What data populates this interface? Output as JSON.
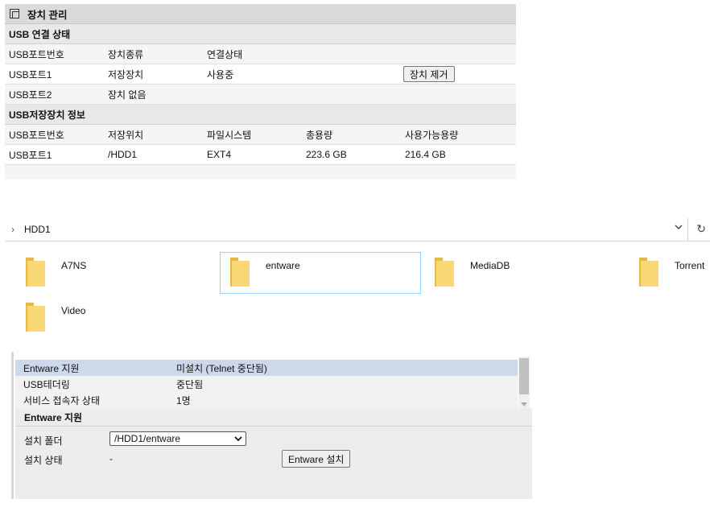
{
  "device_mgmt": {
    "title": "장치 관리",
    "usb_conn": {
      "section": "USB 연결 상태",
      "headers": [
        "USB포트번호",
        "장치종류",
        "연결상태"
      ],
      "rows": [
        {
          "port": "USB포트1",
          "type": "저장장치",
          "status": "사용중",
          "action": "장치 제거"
        },
        {
          "port": "USB포트2",
          "type": "장치 없음",
          "status": ""
        }
      ]
    },
    "storage": {
      "section": "USB저장장치 정보",
      "headers": [
        "USB포트번호",
        "저장위치",
        "파일시스템",
        "총용량",
        "사용가능용량"
      ],
      "rows": [
        {
          "port": "USB포트1",
          "location": "/HDD1",
          "fs": "EXT4",
          "total": "223.6 GB",
          "free": "216.4 GB"
        }
      ]
    }
  },
  "explorer": {
    "path": "HDD1",
    "folders": [
      "A7NS",
      "entware",
      "MediaDB",
      "Torrent",
      "Video"
    ],
    "selected": "entware",
    "icons": {
      "breadcrumb": "chevron-right-icon",
      "dropdown": "chevron-down-icon",
      "refresh": "refresh-icon",
      "folder": "folder-icon"
    }
  },
  "entware": {
    "statuses": [
      {
        "label": "Entware 지원",
        "value": "미설치 (Telnet 중단됨)"
      },
      {
        "label": "USB테더링",
        "value": "중단됨"
      },
      {
        "label": "서비스 접속자 상태",
        "value": "1명"
      }
    ],
    "section": "Entware 지원",
    "install_folder_label": "설치 폴더",
    "install_folder_value": "/HDD1/entware",
    "install_status_label": "설치 상태",
    "install_status_value": "-",
    "install_button": "Entware 설치"
  },
  "colors": {
    "folder": "#f5c542",
    "selection": "#99d1ff",
    "status_selected": "#cdd8ea"
  }
}
